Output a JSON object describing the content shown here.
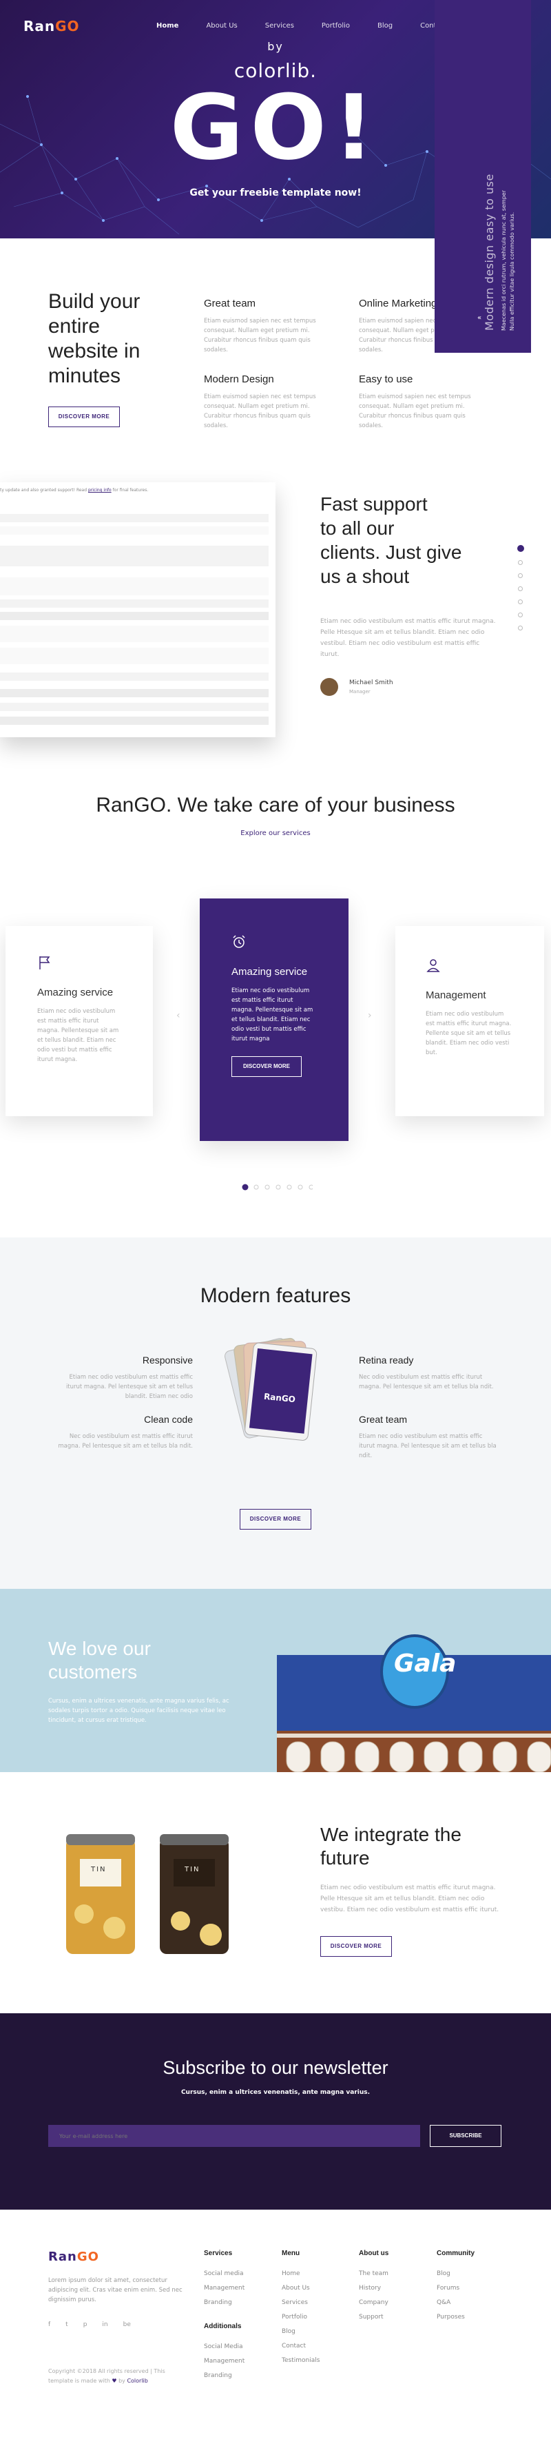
{
  "brand": {
    "name_a": "Ran",
    "name_b": "GO"
  },
  "nav": {
    "items": [
      {
        "label": "Home",
        "active": true
      },
      {
        "label": "About Us"
      },
      {
        "label": "Services"
      },
      {
        "label": "Portfolio"
      },
      {
        "label": "Blog"
      },
      {
        "label": "Contact"
      }
    ],
    "search_icon": "search-icon"
  },
  "hero": {
    "by": "by",
    "colorlib": "colorlib.",
    "go": "GO!",
    "tagline": "Get your freebie template now!"
  },
  "side_panel": {
    "title": "Modern design easy to use",
    "text": "Maecenas id orci rutrum, vehicula nunc at, semper",
    "text2": "Nulla efficitur vitae ligula commodo varius.",
    "arrow": "«"
  },
  "intro": {
    "heading_lines": [
      "Build your",
      "entire",
      "website in",
      "minutes"
    ],
    "button": "DISCOVER MORE",
    "features": [
      {
        "title": "Great team",
        "text": "Etiam euismod sapien nec est tempus consequat. Nullam eget pretium mi. Curabitur rhoncus finibus quam quis sodales."
      },
      {
        "title": "Online Marketing",
        "text": "Etiam euismod sapien nec est tempus consequat. Nullam eget pretium mi. Curabitur rhoncus finibus quam quis sodales."
      },
      {
        "title": "Modern Design",
        "text": "Etiam euismod sapien nec est tempus consequat. Nullam eget pretium mi. Curabitur rhoncus finibus quam quis sodales."
      },
      {
        "title": "Easy to use",
        "text": "Etiam euismod sapien nec est tempus consequat. Nullam eget pretium mi. Curabitur rhoncus finibus quam quis sodales."
      }
    ]
  },
  "support": {
    "heading_lines": [
      "Fast support",
      "to all our",
      "clients. Just give",
      "us a shout"
    ],
    "text": "Etiam nec odio vestibulum est mattis effic iturut magna. Pelle Htesque sit am et tellus blandit. Etiam nec odio vestibul. Etiam nec odio vestibulum est mattis effic iturut.",
    "person_name": "Michael Smith",
    "person_role": "Manager",
    "mock_top_text": "ty update and also granted support! Read",
    "mock_link": "pricing info",
    "mock_top_text2": "for final features."
  },
  "services": {
    "title": "RanGO. We take care of your business",
    "link": "Explore our services",
    "cards": [
      {
        "title": "Amazing service",
        "icon": "flag-icon",
        "text": "Etiam nec odio vestibulum est mattis effic iturut magna. Pellentesque sit am et tellus blandit. Etiam nec odio vesti but mattis effic iturut magna."
      },
      {
        "title": "Amazing service",
        "icon": "alarm-clock-icon",
        "text": "Etiam nec odio vestibulum est mattis effic iturut magna. Pellentesque sit am et tellus blandit. Etiam nec odio vesti but mattis effic iturut magna",
        "button": "DISCOVER MORE"
      },
      {
        "title": "Management",
        "icon": "user-icon",
        "text": "Etiam nec odio vestibulum est mattis effic iturut magna. Pellente sque sit am et tellus blandit. Etiam nec odio vesti but."
      }
    ],
    "arrow_left": "‹",
    "arrow_right": "›"
  },
  "modern": {
    "title": "Modern features",
    "button": "DISCOVER MORE",
    "device_label": "RanGO",
    "left": [
      {
        "title": "Responsive",
        "text": "Etiam nec odio vestibulum est mattis effic iturut magna. Pel lentesque sit am et tellus blandit. Etiam nec odio"
      },
      {
        "title": "Clean code",
        "text": "Nec odio vestibulum est mattis effic iturut magna. Pel lentesque sit am et tellus bla ndit."
      }
    ],
    "right": [
      {
        "title": "Retina ready",
        "text": "Nec odio vestibulum est mattis effic iturut magna. Pel lentesque sit am et tellus bla ndit."
      },
      {
        "title": "Great team",
        "text": "Etiam nec odio vestibulum est mattis effic iturut magna. Pel lentesque sit am et tellus bla ndit."
      }
    ]
  },
  "love": {
    "heading_lines": [
      "We love our",
      "customers"
    ],
    "text": "Cursus, enim a ultrices venenatis, ante magna varius felis, ac sodales turpis tortor a odio. Quisque facilisis neque vitae leo tincidunt, at cursus erat tristique.",
    "sign": "Gala"
  },
  "integrate": {
    "heading_lines": [
      "We integrate the",
      "future"
    ],
    "text": "Etiam nec odio vestibulum est mattis effic iturut magna. Pelle Htesque sit am et tellus blandit. Etiam nec odio vestibu. Etiam nec odio vestibulum est mattis effic iturut.",
    "button": "DISCOVER MORE",
    "can_label": "TIN"
  },
  "newsletter": {
    "title": "Subscribe to our newsletter",
    "text": "Cursus, enim a ultrices venenatis, ante magna varius.",
    "placeholder": "Your e-mail address here",
    "button": "SUBSCRIBE"
  },
  "footer": {
    "text": "Lorem ipsum dolor sit amet, consectetur adipiscing elit. Cras vitae enim enim. Sed nec dignissim purus.",
    "socials": [
      "f",
      "t",
      "p",
      "in",
      "be"
    ],
    "copyright": "Copyright ©2018 All rights reserved | This template is made with",
    "by": "by",
    "colorlib": "Colorlib",
    "cols": [
      {
        "title": "Services",
        "items": [
          "Social media",
          "Management",
          "Branding"
        ]
      },
      {
        "title": "Menu",
        "items": [
          "Home",
          "About Us",
          "Services",
          "Portfolio",
          "Blog",
          "Contact",
          "Testimonials"
        ]
      },
      {
        "title": "About us",
        "items": [
          "The team",
          "History",
          "Company",
          "Support"
        ]
      },
      {
        "title": "Community",
        "items": [
          "Blog",
          "Forums",
          "Q&A",
          "Purposes"
        ]
      }
    ],
    "extra_col": {
      "title": "Additionals",
      "items": [
        "Social Media",
        "Management",
        "Branding"
      ]
    }
  },
  "colors": {
    "purple": "#3d2478",
    "orange": "#f26522",
    "dark": "#221538"
  }
}
